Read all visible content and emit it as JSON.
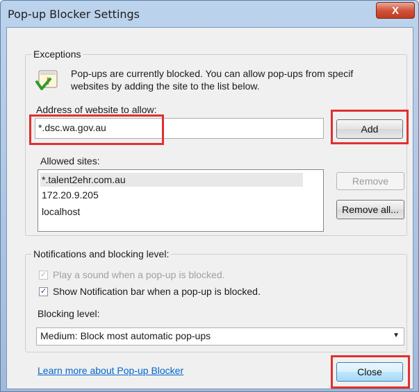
{
  "window": {
    "title": "Pop-up Blocker Settings",
    "close_glyph": "X"
  },
  "exceptions": {
    "legend": "Exceptions",
    "info_line1": "Pop-ups are currently blocked.  You can allow pop-ups from specif",
    "info_line2": "websites by adding the site to the list below.",
    "address_label": "Address of website to allow:",
    "address_value": "*.dsc.wa.gov.au",
    "add_label": "Add",
    "allowed_label": "Allowed sites:",
    "allowed_sites": [
      "*.talent2ehr.com.au",
      "172.20.9.205",
      "localhost"
    ],
    "remove_label": "Remove",
    "remove_all_label": "Remove all..."
  },
  "notifications": {
    "legend": "Notifications and blocking level:",
    "play_sound_label": "Play a sound when a pop-up is blocked.",
    "play_sound_checked": true,
    "show_bar_label": "Show Notification bar when a pop-up is blocked.",
    "show_bar_checked": true,
    "blocking_level_label": "Blocking level:",
    "blocking_level_value": "Medium: Block most automatic pop-ups"
  },
  "footer": {
    "learn_more": "Learn more about Pop-up Blocker",
    "close_label": "Close"
  },
  "icons": {
    "info": "shield-warning-icon",
    "checkmark": "checkmark-icon",
    "dropdown": "chevron-down-icon"
  },
  "colors": {
    "highlight_box": "#e03030",
    "link": "#0066cc"
  }
}
